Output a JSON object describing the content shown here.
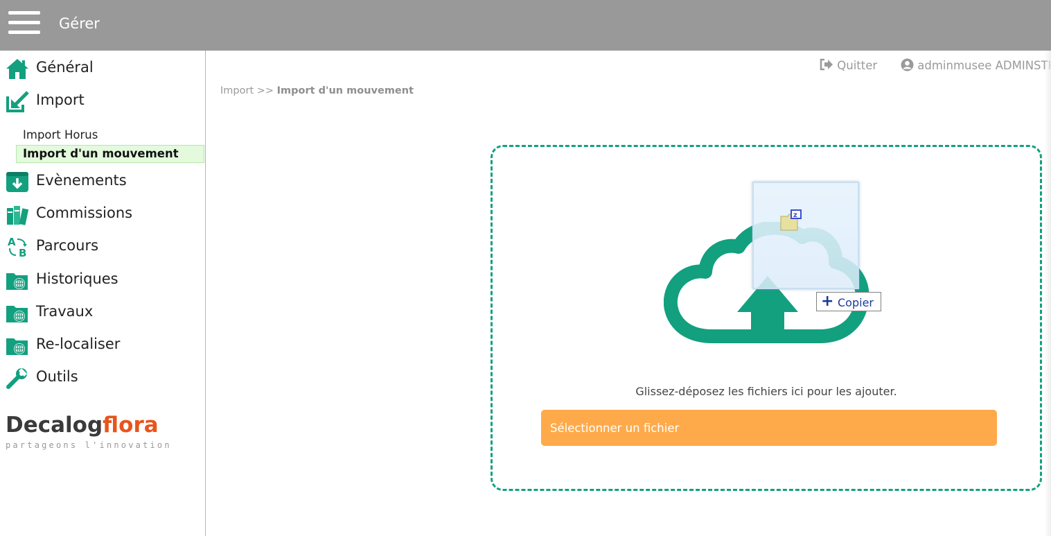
{
  "header": {
    "title": "Gérer",
    "menu_icon": "hamburger-icon"
  },
  "sidebar": {
    "items": [
      {
        "label": "Général",
        "icon": "home-icon"
      },
      {
        "label": "Import",
        "icon": "import-icon",
        "subitems": [
          {
            "label": "Import Horus",
            "active": false
          },
          {
            "label": "Import d'un mouvement",
            "active": true
          }
        ]
      },
      {
        "label": "Evènements",
        "icon": "download-box-icon"
      },
      {
        "label": "Commissions",
        "icon": "books-icon"
      },
      {
        "label": "Parcours",
        "icon": "ab-route-icon"
      },
      {
        "label": "Historiques",
        "icon": "folder-globe-icon"
      },
      {
        "label": "Travaux",
        "icon": "folder-globe-icon"
      },
      {
        "label": "Re-localiser",
        "icon": "folder-globe-icon"
      },
      {
        "label": "Outils",
        "icon": "wrench-icon"
      }
    ],
    "logo": {
      "brand": "Decalog",
      "product": "flora",
      "tagline": "partageons l'innovation"
    }
  },
  "topbar": {
    "quit_label": "Quitter",
    "user_label": "adminmusee ADMINSTR"
  },
  "breadcrumb": {
    "parent": "Import",
    "separator": ">>",
    "current": "Import d'un mouvement"
  },
  "upload": {
    "hint": "Glissez-déposez les fichiers ici pour les ajouter.",
    "button_label": "Sélectionner un fichier",
    "drag_tooltip": "Copier"
  },
  "colors": {
    "accent": "#12a07f",
    "button": "#ffaa4a",
    "topbar": "#999999",
    "active_bg": "#e3fadd",
    "brand_orange": "#e8541c"
  }
}
